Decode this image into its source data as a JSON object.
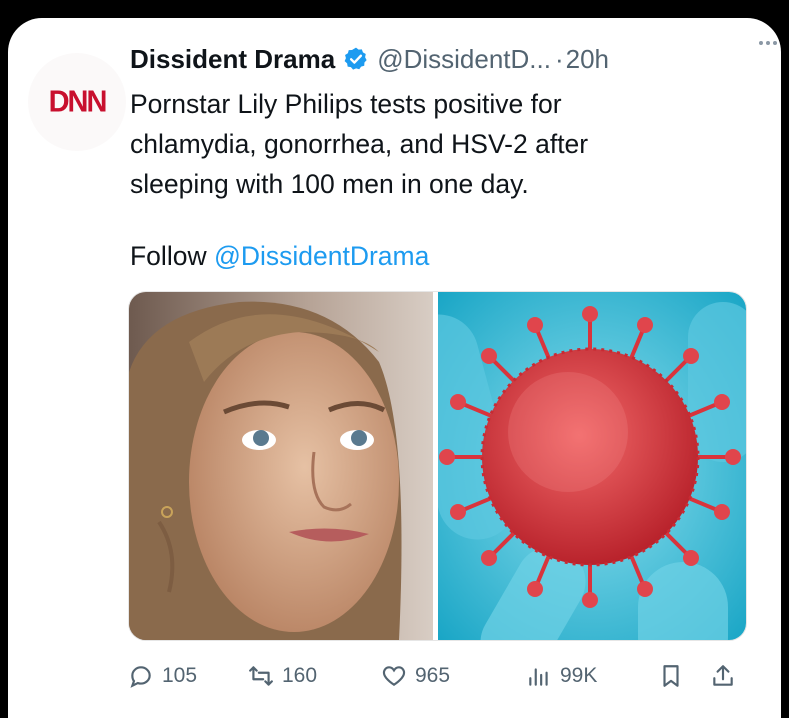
{
  "tweet": {
    "avatar_text": "DNN",
    "display_name": "Dissident Drama",
    "verified": true,
    "handle": "@DissidentD...",
    "separator": "·",
    "time": "20h",
    "text_line1": "Pornstar Lily Philips tests positive for",
    "text_line2": "chlamydia, gonorrhea, and HSV-2 after",
    "text_line3": "sleeping with 100 men in one day.",
    "follow_prefix": "Follow",
    "follow_handle": "@DissidentDrama",
    "media": [
      {
        "description_icon": "woman-portrait-photo"
      },
      {
        "description_icon": "virus-illustration"
      }
    ]
  },
  "actions": {
    "replies": "105",
    "reposts": "160",
    "likes": "965",
    "views": "99K"
  },
  "colors": {
    "background": "#000000",
    "card": "#ffffff",
    "link": "#1d9bf0",
    "verified": "#1d9bf0",
    "muted": "#536471",
    "logo_red": "#c8102e"
  }
}
